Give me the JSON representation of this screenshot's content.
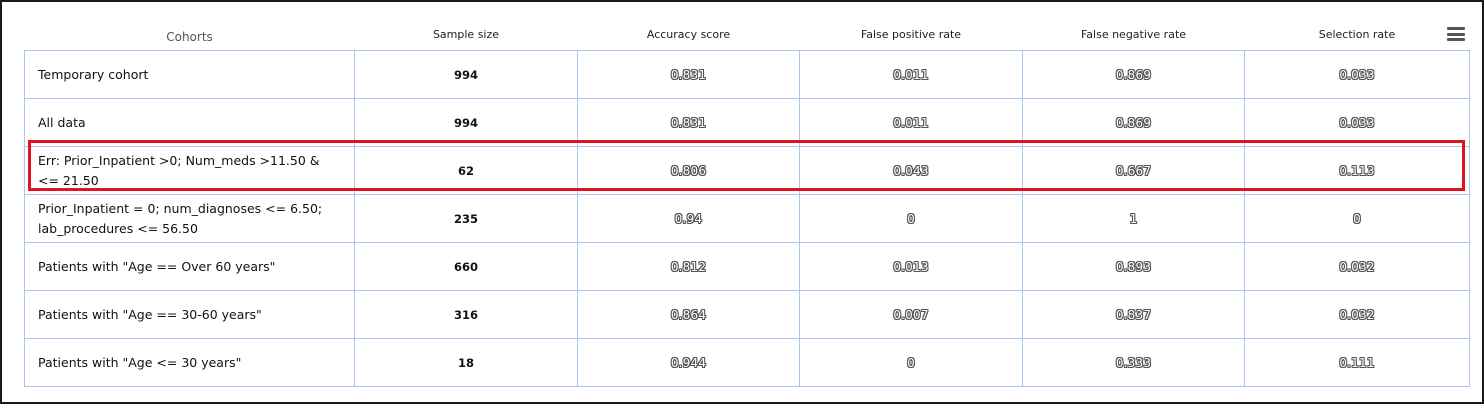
{
  "table": {
    "headers": {
      "cohorts": "Cohorts",
      "sample_size": "Sample size",
      "accuracy": "Accuracy score",
      "fpr": "False positive rate",
      "fnr": "False negative rate",
      "selection": "Selection rate"
    },
    "rows": [
      {
        "name": "Temporary cohort",
        "sample_size": "994",
        "accuracy": "0.831",
        "fpr": "0.011",
        "fnr": "0.869",
        "selection": "0.033"
      },
      {
        "name": "All data",
        "sample_size": "994",
        "accuracy": "0.831",
        "fpr": "0.011",
        "fnr": "0.869",
        "selection": "0.033"
      },
      {
        "name": "Err: Prior_Inpatient >0; Num_meds >11.50 & <= 21.50",
        "sample_size": "62",
        "accuracy": "0.806",
        "fpr": "0.043",
        "fnr": "0.667",
        "selection": "0.113"
      },
      {
        "name": "Prior_Inpatient = 0; num_diagnoses <= 6.50; lab_procedures <= 56.50",
        "sample_size": "235",
        "accuracy": "0.94",
        "fpr": "0",
        "fnr": "1",
        "selection": "0"
      },
      {
        "name": "Patients with \"Age == Over 60 years\"",
        "sample_size": "660",
        "accuracy": "0.812",
        "fpr": "0.013",
        "fnr": "0.893",
        "selection": "0.032"
      },
      {
        "name": "Patients with \"Age == 30-60 years\"",
        "sample_size": "316",
        "accuracy": "0.864",
        "fpr": "0.007",
        "fnr": "0.837",
        "selection": "0.032"
      },
      {
        "name": "Patients with \"Age <= 30 years\"",
        "sample_size": "18",
        "accuracy": "0.944",
        "fpr": "0",
        "fnr": "0.333",
        "selection": "0.111"
      }
    ]
  },
  "menu_icon": "hamburger-menu-icon",
  "highlight_color": "#e0141e",
  "grid_border_color": "#a9c6ec"
}
